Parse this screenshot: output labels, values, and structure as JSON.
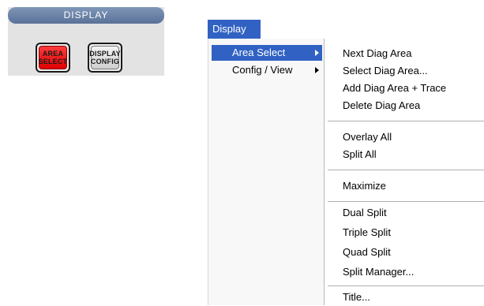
{
  "hardware_panel": {
    "header": "DISPLAY",
    "keys": [
      {
        "line1": "AREA",
        "line2": "SELECT",
        "color": "#e00000"
      },
      {
        "line1": "DISPLAY",
        "line2": "CONFIG",
        "color": "#d8d8d8"
      }
    ]
  },
  "menubar": {
    "title": "Display"
  },
  "menu": {
    "items": [
      {
        "label": "Area Select",
        "has_submenu": true,
        "highlighted": true
      },
      {
        "label": "Config / View",
        "has_submenu": true,
        "highlighted": false
      }
    ]
  },
  "submenu": {
    "groups": [
      [
        "Next Diag Area",
        "Select Diag Area...",
        "Add Diag Area + Trace",
        "Delete Diag Area"
      ],
      [
        "Overlay All",
        "Split All"
      ],
      [
        "Maximize"
      ],
      [
        "Dual Split",
        "Triple Split",
        "Quad Split",
        "Split Manager..."
      ],
      [
        "Title..."
      ]
    ]
  },
  "colors": {
    "highlight": "#3162c3",
    "panel_header": "#6b83a8",
    "active_key": "#e00000"
  }
}
